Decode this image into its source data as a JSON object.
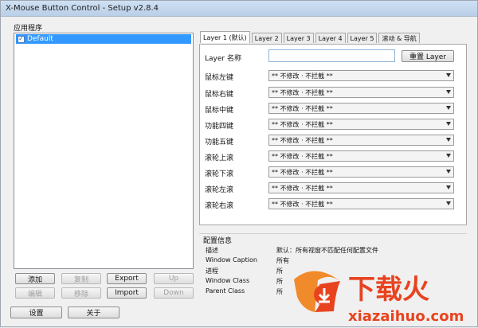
{
  "window": {
    "title": "X-Mouse Button Control - Setup v2.8.4"
  },
  "apps": {
    "label": "应用程序",
    "items": [
      {
        "name": "Default",
        "checked": true
      }
    ]
  },
  "left_buttons": {
    "add": "添加",
    "copy": "复制",
    "export": "Export",
    "up": "Up",
    "edit": "编辑",
    "remove": "移除",
    "import": "Import",
    "down": "Down"
  },
  "bottom_buttons": {
    "settings": "设置",
    "about": "关于"
  },
  "tabs": [
    "Layer 1 (默认)",
    "Layer 2",
    "Layer 3",
    "Layer 4",
    "Layer 5",
    "滚动 & 导航"
  ],
  "layer": {
    "name_label": "Layer 名称",
    "name_value": "",
    "reset_button": "重置 Layer"
  },
  "mappings": [
    {
      "label": "鼠标左键",
      "value": "** 不修改 · 不拦截 **"
    },
    {
      "label": "鼠标右键",
      "value": "** 不修改 · 不拦截 **"
    },
    {
      "label": "鼠标中键",
      "value": "** 不修改 · 不拦截 **"
    },
    {
      "label": "功能四键",
      "value": "** 不修改 · 不拦截 **"
    },
    {
      "label": "功能五键",
      "value": "** 不修改 · 不拦截 **"
    },
    {
      "label": "滚轮上滚",
      "value": "** 不修改 · 不拦截 **"
    },
    {
      "label": "滚轮下滚",
      "value": "** 不修改 · 不拦截 **"
    },
    {
      "label": "滚轮左滚",
      "value": "** 不修改 · 不拦截 **"
    },
    {
      "label": "滚轮右滚",
      "value": "** 不修改 · 不拦截 **"
    }
  ],
  "config_info": {
    "title": "配置信息",
    "rows": [
      {
        "label": "描述",
        "value": "默认：所有视窗不匹配任何配置文件"
      },
      {
        "label": "Window Caption",
        "value": "所有"
      },
      {
        "label": "进程",
        "value": "所"
      },
      {
        "label": "Window Class",
        "value": "所"
      },
      {
        "label": "Parent Class",
        "value": "所"
      }
    ]
  },
  "watermark": {
    "text_cn": "下载火",
    "text_en": "xiazaihuo.com",
    "color": "#e8431f"
  }
}
